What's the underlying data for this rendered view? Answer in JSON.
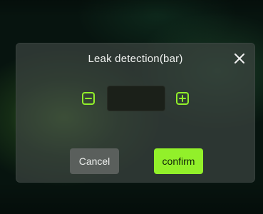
{
  "dialog": {
    "title": "Leak detection(bar)",
    "close_icon": "close-icon",
    "stepper": {
      "decrement_icon": "minus-square-icon",
      "increment_icon": "plus-square-icon",
      "value": "",
      "placeholder": ""
    },
    "cancel_label": "Cancel",
    "confirm_label": "confirm"
  },
  "colors": {
    "accent": "#92f02a",
    "dialog_bg": "#3c4440",
    "field_bg": "#1b2019",
    "cancel_bg": "#5a5f5c"
  }
}
